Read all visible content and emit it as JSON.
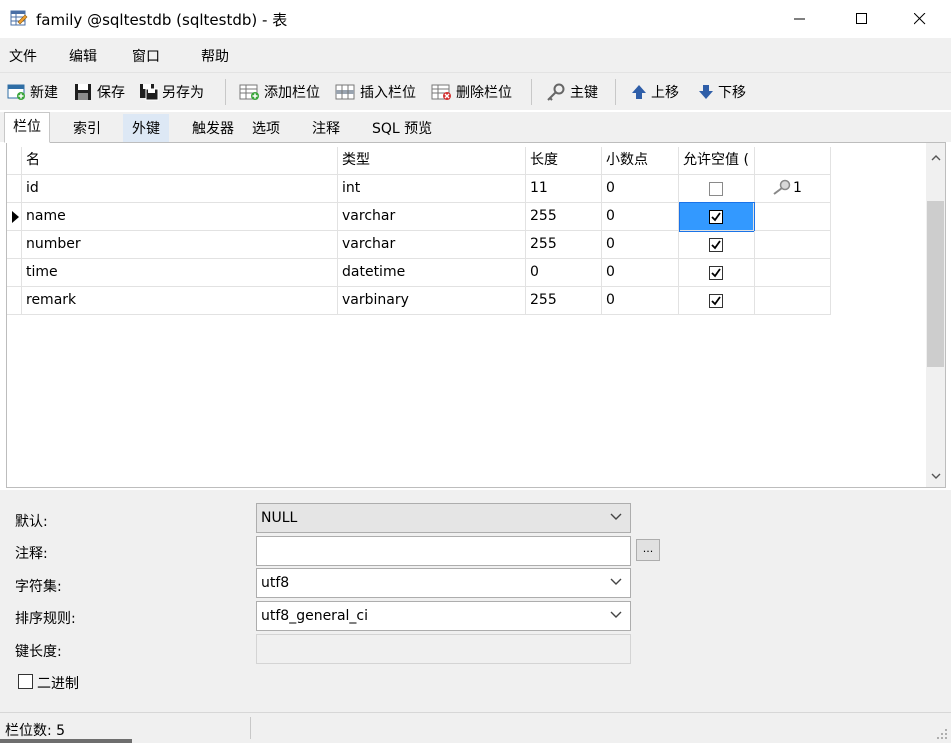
{
  "window": {
    "title": "family @sqltestdb (sqltestdb) - 表"
  },
  "menu": [
    "文件",
    "编辑",
    "窗口",
    "帮助"
  ],
  "toolbar": {
    "new": "新建",
    "save": "保存",
    "save_as": "另存为",
    "add_field": "添加栏位",
    "insert_field": "插入栏位",
    "delete_field": "删除栏位",
    "primary_key": "主键",
    "move_up": "上移",
    "move_down": "下移"
  },
  "tabs": [
    "栏位",
    "索引",
    "外键",
    "触发器",
    "选项",
    "注释",
    "SQL 预览"
  ],
  "grid": {
    "headers": [
      "名",
      "类型",
      "长度",
      "小数点",
      "允许空值 ("
    ],
    "rows": [
      {
        "name": "id",
        "type": "int",
        "length": "11",
        "decimals": "0",
        "allow_null": false,
        "key": "1"
      },
      {
        "name": "name",
        "type": "varchar",
        "length": "255",
        "decimals": "0",
        "allow_null": true,
        "key": ""
      },
      {
        "name": "number",
        "type": "varchar",
        "length": "255",
        "decimals": "0",
        "allow_null": true,
        "key": ""
      },
      {
        "name": "time",
        "type": "datetime",
        "length": "0",
        "decimals": "0",
        "allow_null": true,
        "key": ""
      },
      {
        "name": "remark",
        "type": "varbinary",
        "length": "255",
        "decimals": "0",
        "allow_null": true,
        "key": ""
      }
    ]
  },
  "props": {
    "default_label": "默认:",
    "default_value": "NULL",
    "comment_label": "注释:",
    "comment_value": "",
    "charset_label": "字符集:",
    "charset_value": "utf8",
    "collation_label": "排序规则:",
    "collation_value": "utf8_general_ci",
    "keylength_label": "键长度:",
    "keylength_value": "",
    "binary_label": "二进制",
    "ellipsis": "..."
  },
  "status": {
    "field_count": "栏位数: 5"
  }
}
